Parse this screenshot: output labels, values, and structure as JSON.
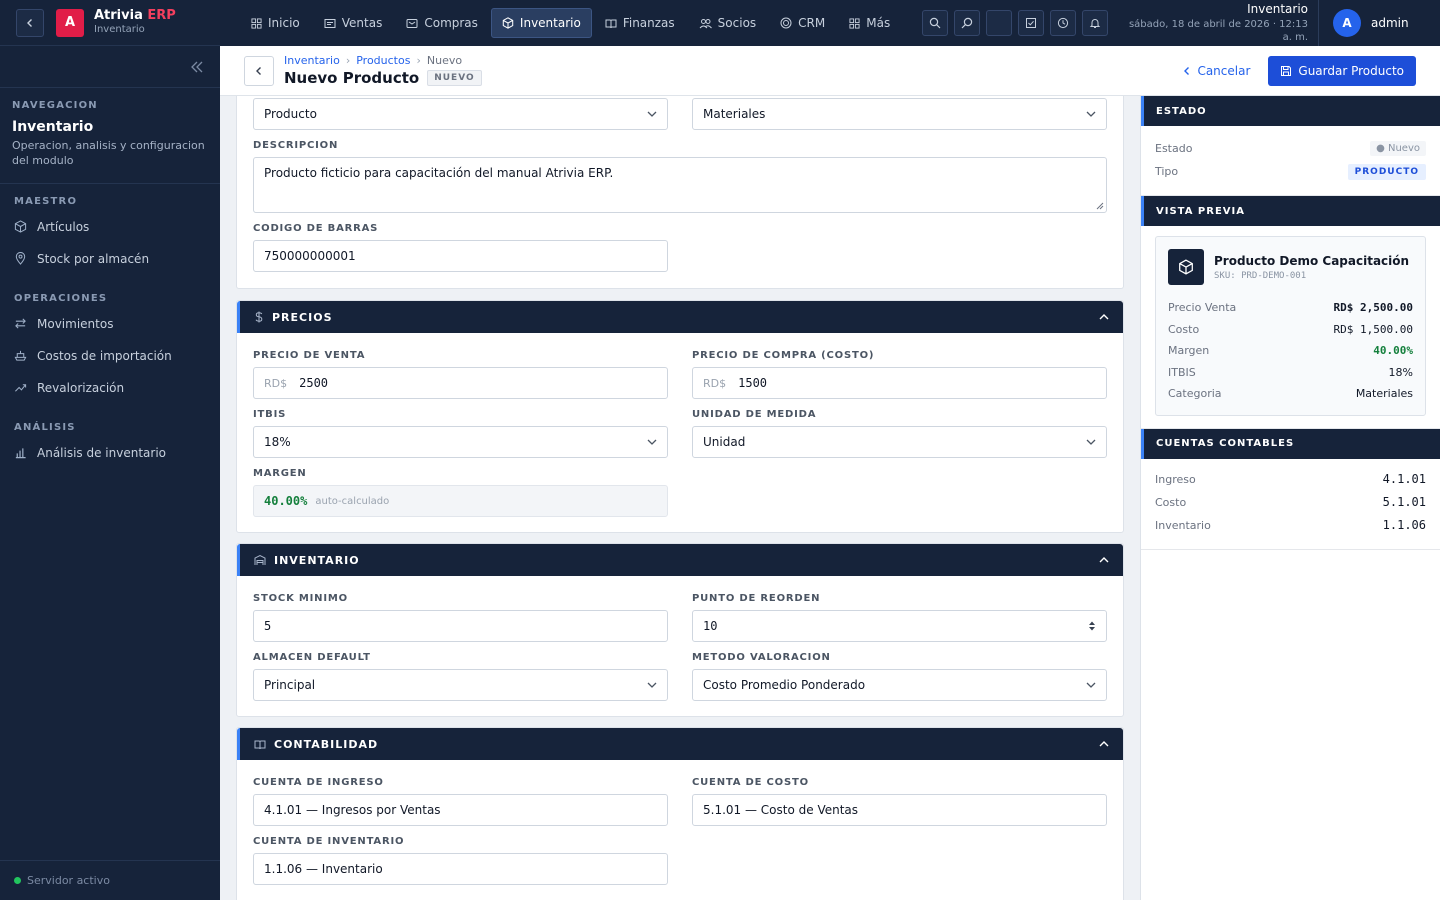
{
  "app": {
    "brand": "Atrivia",
    "brand_accent": "ERP",
    "module": "Inventario",
    "logo_letter": "A"
  },
  "sidebar": {
    "nav_label": "NAVEGACION",
    "module_title": "Inventario",
    "module_desc": "Operacion, analisis y configuracion del modulo",
    "groups": [
      {
        "label": "MAESTRO",
        "items": [
          {
            "label": "Artículos",
            "icon": "cube-icon"
          },
          {
            "label": "Stock por almacén",
            "icon": "location-icon"
          }
        ]
      },
      {
        "label": "OPERACIONES",
        "items": [
          {
            "label": "Movimientos",
            "icon": "arrows-icon"
          },
          {
            "label": "Costos de importación",
            "icon": "ship-icon"
          },
          {
            "label": "Revalorización",
            "icon": "trend-icon"
          }
        ]
      },
      {
        "label": "ANÁLISIS",
        "items": [
          {
            "label": "Análisis de inventario",
            "icon": "bar-chart-icon"
          }
        ]
      }
    ],
    "footer": "Servidor activo"
  },
  "topbar": {
    "tabs": [
      {
        "label": "Inicio",
        "icon": "grid-icon"
      },
      {
        "label": "Ventas",
        "icon": "receipt-icon"
      },
      {
        "label": "Compras",
        "icon": "cart-icon"
      },
      {
        "label": "Inventario",
        "icon": "cube-icon",
        "active": true
      },
      {
        "label": "Finanzas",
        "icon": "book-icon"
      },
      {
        "label": "Socios",
        "icon": "users-icon"
      },
      {
        "label": "CRM",
        "icon": "target-icon"
      },
      {
        "label": "Más",
        "icon": "grid-icon"
      }
    ],
    "info_module": "Inventario",
    "info_date": "sábado, 18 de abril de 2026 · 12:13 a. m.",
    "user_initial": "A",
    "user_name": "admin"
  },
  "header": {
    "breadcrumb": [
      "Inventario",
      "Productos",
      "Nuevo"
    ],
    "title": "Nuevo Producto",
    "badge": "NUEVO",
    "cancel": "Cancelar",
    "save": "Guardar Producto"
  },
  "general": {
    "tipo": "Producto",
    "categoria": "Materiales",
    "desc_label": "DESCRIPCION",
    "desc_value": "Producto ficticio para capacitación del manual Atrivia ERP.",
    "barcode_label": "CODIGO DE BARRAS",
    "barcode_value": "750000000001"
  },
  "precios": {
    "title": "PRECIOS",
    "venta_label": "PRECIO DE VENTA",
    "venta_prefix": "RD$",
    "venta_value": "2500",
    "compra_label": "PRECIO DE COMPRA (COSTO)",
    "compra_prefix": "RD$",
    "compra_value": "1500",
    "itbis_label": "ITBIS",
    "itbis_value": "18%",
    "unidad_label": "UNIDAD DE MEDIDA",
    "unidad_value": "Unidad",
    "margen_label": "MARGEN",
    "margen_value": "40.00%",
    "margen_note": "auto-calculado"
  },
  "inventario": {
    "title": "INVENTARIO",
    "stock_label": "STOCK MINIMO",
    "stock_value": "5",
    "reorden_label": "PUNTO DE REORDEN",
    "reorden_value": "10",
    "almacen_label": "ALMACEN DEFAULT",
    "almacen_value": "Principal",
    "metodo_label": "METODO VALORACION",
    "metodo_value": "Costo Promedio Ponderado"
  },
  "contabilidad": {
    "title": "CONTABILIDAD",
    "ingreso_label": "CUENTA DE INGRESO",
    "ingreso_value": "4.1.01 — Ingresos por Ventas",
    "costo_label": "CUENTA DE COSTO",
    "costo_value": "5.1.01 — Costo de Ventas",
    "inv_label": "CUENTA DE INVENTARIO",
    "inv_value": "1.1.06 — Inventario"
  },
  "panel": {
    "estado_title": "ESTADO",
    "estado_label": "Estado",
    "estado_value": "● Nuevo",
    "tipo_label": "Tipo",
    "tipo_value": "PRODUCTO",
    "preview_title": "VISTA PREVIA",
    "preview_name": "Producto Demo Capacitación",
    "preview_sku": "SKU: PRD-DEMO-001",
    "preview_rows": [
      {
        "label": "Precio Venta",
        "value": "RD$ 2,500.00"
      },
      {
        "label": "Costo",
        "value": "RD$ 1,500.00"
      },
      {
        "label": "Margen",
        "value": "40.00%"
      },
      {
        "label": "ITBIS",
        "value": "18%"
      },
      {
        "label": "Categoria",
        "value": "Materiales"
      }
    ],
    "cuentas_title": "CUENTAS CONTABLES",
    "cuentas": [
      {
        "label": "Ingreso",
        "value": "4.1.01"
      },
      {
        "label": "Costo",
        "value": "5.1.01"
      },
      {
        "label": "Inventario",
        "value": "1.1.06"
      }
    ]
  },
  "colors": {
    "sidebar_bg": "#16233a",
    "accent": "#1d4ed8",
    "brand": "#e11d48",
    "success": "#15803d"
  }
}
